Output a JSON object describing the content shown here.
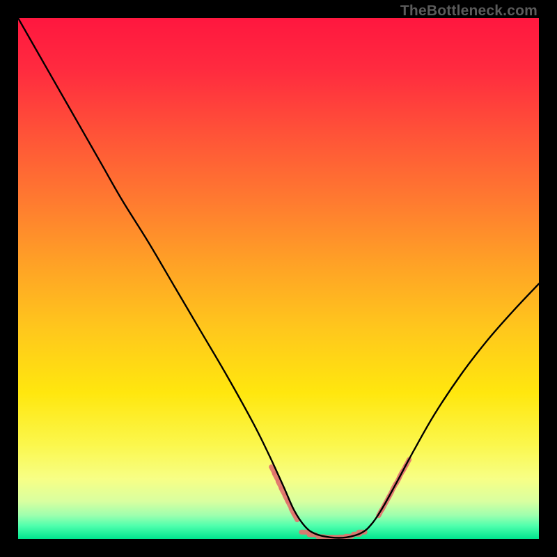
{
  "watermark": "TheBottleneck.com",
  "chart_data": {
    "type": "line",
    "title": "",
    "xlabel": "",
    "ylabel": "",
    "xlim": [
      0,
      100
    ],
    "ylim": [
      0,
      100
    ],
    "gradient_stops": [
      {
        "offset": 0.0,
        "color": "#ff173f"
      },
      {
        "offset": 0.1,
        "color": "#ff2b3f"
      },
      {
        "offset": 0.22,
        "color": "#ff5238"
      },
      {
        "offset": 0.35,
        "color": "#ff7a30"
      },
      {
        "offset": 0.48,
        "color": "#ffa425"
      },
      {
        "offset": 0.6,
        "color": "#ffc81c"
      },
      {
        "offset": 0.72,
        "color": "#ffe70e"
      },
      {
        "offset": 0.82,
        "color": "#fbf74d"
      },
      {
        "offset": 0.885,
        "color": "#f7ff86"
      },
      {
        "offset": 0.928,
        "color": "#d9ffa0"
      },
      {
        "offset": 0.955,
        "color": "#9dffae"
      },
      {
        "offset": 0.975,
        "color": "#4fffad"
      },
      {
        "offset": 1.0,
        "color": "#00e58e"
      }
    ],
    "series": [
      {
        "name": "bottleneck-curve",
        "color": "#000000",
        "points": [
          {
            "x": 0.0,
            "y": 100.0
          },
          {
            "x": 4.0,
            "y": 93.0
          },
          {
            "x": 8.0,
            "y": 86.0
          },
          {
            "x": 12.0,
            "y": 79.0
          },
          {
            "x": 16.0,
            "y": 72.0
          },
          {
            "x": 20.0,
            "y": 65.0
          },
          {
            "x": 25.0,
            "y": 57.0
          },
          {
            "x": 30.0,
            "y": 48.5
          },
          {
            "x": 35.0,
            "y": 40.0
          },
          {
            "x": 40.0,
            "y": 31.5
          },
          {
            "x": 45.0,
            "y": 22.5
          },
          {
            "x": 48.0,
            "y": 16.5
          },
          {
            "x": 51.0,
            "y": 10.0
          },
          {
            "x": 53.0,
            "y": 5.5
          },
          {
            "x": 55.0,
            "y": 2.5
          },
          {
            "x": 57.0,
            "y": 1.0
          },
          {
            "x": 60.0,
            "y": 0.3
          },
          {
            "x": 63.0,
            "y": 0.3
          },
          {
            "x": 66.0,
            "y": 1.2
          },
          {
            "x": 68.0,
            "y": 3.0
          },
          {
            "x": 70.0,
            "y": 6.0
          },
          {
            "x": 72.5,
            "y": 10.5
          },
          {
            "x": 76.0,
            "y": 17.0
          },
          {
            "x": 80.0,
            "y": 24.0
          },
          {
            "x": 85.0,
            "y": 31.5
          },
          {
            "x": 90.0,
            "y": 38.0
          },
          {
            "x": 95.0,
            "y": 43.7
          },
          {
            "x": 100.0,
            "y": 49.0
          }
        ]
      },
      {
        "name": "left-dash-fuzz",
        "color": "#e2736d",
        "type": "scatter",
        "points": [
          {
            "x": 48.9,
            "y": 13.3
          },
          {
            "x": 49.5,
            "y": 12.0
          },
          {
            "x": 50.2,
            "y": 10.5
          },
          {
            "x": 50.8,
            "y": 9.2
          },
          {
            "x": 51.5,
            "y": 7.8
          },
          {
            "x": 52.0,
            "y": 6.8
          },
          {
            "x": 52.7,
            "y": 5.3
          },
          {
            "x": 53.3,
            "y": 4.2
          }
        ]
      },
      {
        "name": "trough-dash-fuzz",
        "color": "#e2736d",
        "type": "scatter",
        "points": [
          {
            "x": 55.0,
            "y": 1.3
          },
          {
            "x": 56.5,
            "y": 0.8
          },
          {
            "x": 58.2,
            "y": 0.4
          },
          {
            "x": 59.8,
            "y": 0.3
          },
          {
            "x": 60.8,
            "y": 0.3
          },
          {
            "x": 62.3,
            "y": 0.35
          },
          {
            "x": 63.5,
            "y": 0.5
          },
          {
            "x": 65.0,
            "y": 0.9
          },
          {
            "x": 66.0,
            "y": 1.3
          }
        ]
      },
      {
        "name": "right-dash-fuzz",
        "color": "#e2736d",
        "type": "scatter",
        "points": [
          {
            "x": 69.5,
            "y": 5.0
          },
          {
            "x": 70.2,
            "y": 6.2
          },
          {
            "x": 70.9,
            "y": 7.5
          },
          {
            "x": 71.5,
            "y": 8.6
          },
          {
            "x": 72.2,
            "y": 10.0
          },
          {
            "x": 72.9,
            "y": 11.2
          },
          {
            "x": 73.5,
            "y": 12.4
          },
          {
            "x": 74.2,
            "y": 13.6
          },
          {
            "x": 74.8,
            "y": 14.7
          }
        ]
      }
    ]
  }
}
